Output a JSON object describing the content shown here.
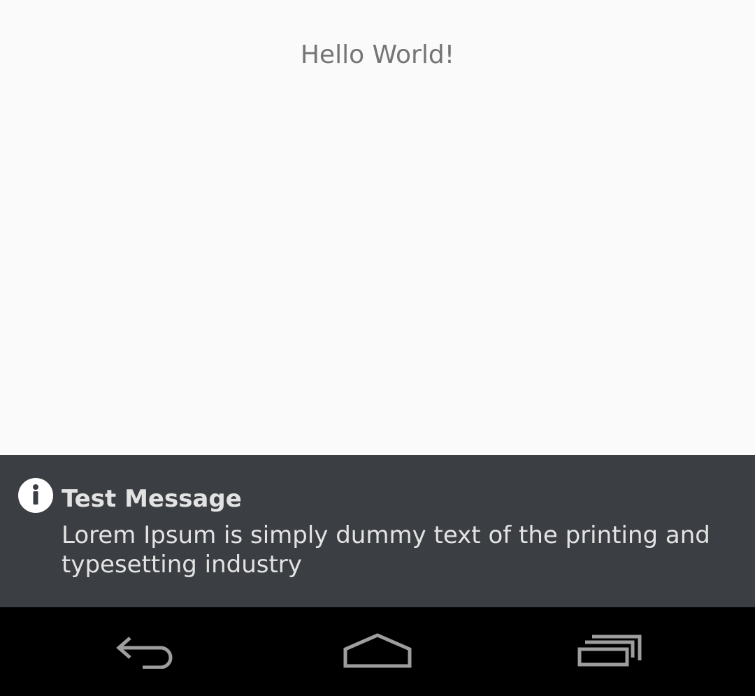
{
  "main": {
    "hello_text": "Hello World!"
  },
  "notification": {
    "icon": "info-icon",
    "title": "Test Message",
    "body": "Lorem Ipsum is simply dummy text of the printing and typesetting industry"
  },
  "navbar": {
    "buttons": [
      {
        "icon": "back-icon"
      },
      {
        "icon": "home-icon"
      },
      {
        "icon": "recent-apps-icon"
      }
    ]
  },
  "colors": {
    "background": "#fafafa",
    "banner": "#3b3e42",
    "navbar": "#000000",
    "hello_text": "#757575",
    "banner_text": "#e3e3e3",
    "nav_icon": "#9e9e9e"
  }
}
